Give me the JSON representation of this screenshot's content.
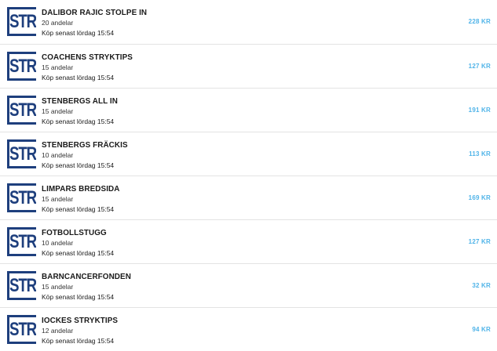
{
  "brand": {
    "logo_text": "STR",
    "logo_color": "#1e3f7d"
  },
  "colors": {
    "price": "#4fb3e8",
    "divider": "#e3e3e3"
  },
  "items": [
    {
      "title": "DALIBOR RAJIC STOLPE IN",
      "shares": "20 andelar",
      "deadline": "Köp senast lördag 15:54",
      "price": "228 KR"
    },
    {
      "title": "COACHENS STRYKTIPS",
      "shares": "15 andelar",
      "deadline": "Köp senast lördag 15:54",
      "price": "127 KR"
    },
    {
      "title": "STENBERGS ALL IN",
      "shares": "15 andelar",
      "deadline": "Köp senast lördag 15:54",
      "price": "191 KR"
    },
    {
      "title": "STENBERGS FRÄCKIS",
      "shares": "10 andelar",
      "deadline": "Köp senast lördag 15:54",
      "price": "113 KR"
    },
    {
      "title": "LIMPARS BREDSIDA",
      "shares": "15 andelar",
      "deadline": "Köp senast lördag 15:54",
      "price": "169 KR"
    },
    {
      "title": "FOTBOLLSTUGG",
      "shares": "10 andelar",
      "deadline": "Köp senast lördag 15:54",
      "price": "127 KR"
    },
    {
      "title": "BARNCANCERFONDEN",
      "shares": "15 andelar",
      "deadline": "Köp senast lördag 15:54",
      "price": "32 KR"
    },
    {
      "title": "IOCKES STRYKTIPS",
      "shares": "12 andelar",
      "deadline": "Köp senast lördag 15:54",
      "price": "94 KR"
    }
  ]
}
